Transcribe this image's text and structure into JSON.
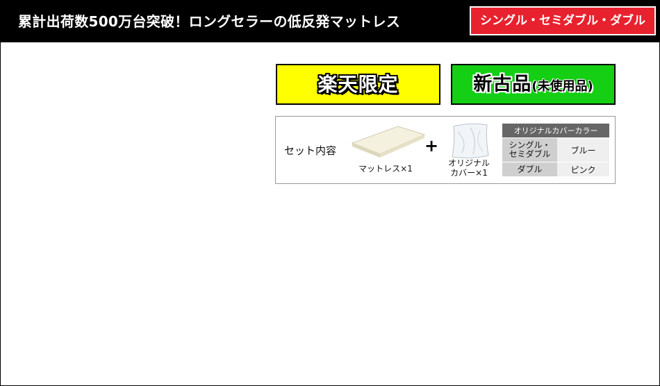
{
  "banner": {
    "title": "累計出荷数500万台突破！ロングセラーの低反発マットレス",
    "size_badge": "シングル・セミダブル・ダブル"
  },
  "labels": {
    "rakuten_limited": "楽天限定",
    "new_item_main": "新古品",
    "new_item_sub": "(未使用品)"
  },
  "set_contents": {
    "label": "セット内容",
    "mattress_caption": "マットレス×1",
    "plus": "+",
    "cover_caption_line1": "オリジナル",
    "cover_caption_line2": "カバー×1"
  },
  "cover_colors": {
    "header": "オリジナルカバーカラー",
    "rows": [
      {
        "size_line1": "シングル・",
        "size_line2": "セミダブル",
        "color": "ブルー"
      },
      {
        "size_line1": "ダブル",
        "size_line2": "",
        "color": "ピンク"
      }
    ]
  },
  "colors": {
    "banner_bg": "#000000",
    "badge_red": "#e8212e",
    "rakuten_yellow": "#ffff00",
    "shinko_green": "#14cf14"
  },
  "icons": [
    "mattress-image",
    "cover-image"
  ]
}
